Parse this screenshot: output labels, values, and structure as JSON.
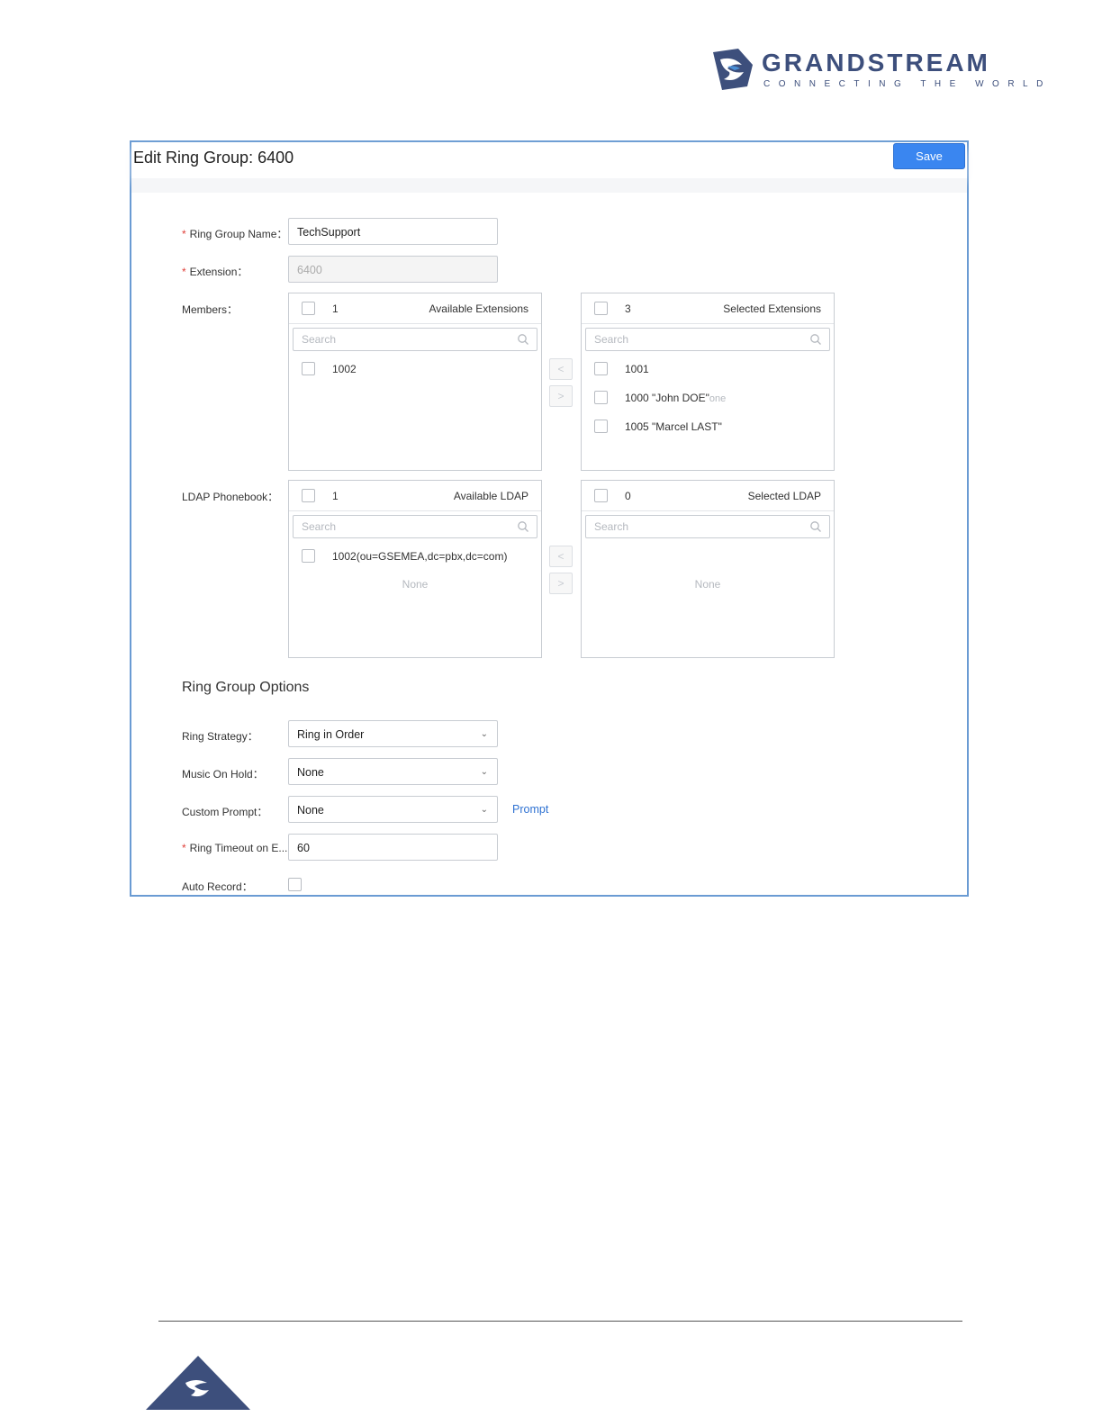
{
  "brand": {
    "name": "GRANDSTREAM",
    "tagline": "CONNECTING THE WORLD",
    "primary_color": "#3d4f7c",
    "icon": "grandstream-logo-icon"
  },
  "header": {
    "title": "Edit Ring Group: 6400",
    "save_label": "Save"
  },
  "form": {
    "ring_group_name": {
      "label": "Ring Group Name：",
      "value": "TechSupport",
      "required": true
    },
    "extension": {
      "label": "Extension：",
      "value": "6400",
      "required": true,
      "disabled": true
    },
    "members": {
      "label": "Members：",
      "available": {
        "count": "1",
        "title": "Available Extensions",
        "search_placeholder": "Search",
        "items": [
          "1002"
        ]
      },
      "selected": {
        "count": "3",
        "title": "Selected Extensions",
        "search_placeholder": "Search",
        "items": [
          "1001",
          "1000 \"John DOE\"",
          "1005 \"Marcel LAST\""
        ],
        "ghost_text": "one"
      },
      "move_left": "<",
      "move_right": ">"
    },
    "ldap": {
      "label": "LDAP Phonebook：",
      "available": {
        "count": "1",
        "title": "Available LDAP",
        "search_placeholder": "Search",
        "items": [
          "1002(ou=GSEMEA,dc=pbx,dc=com)"
        ],
        "empty_text": "None"
      },
      "selected": {
        "count": "0",
        "title": "Selected LDAP",
        "search_placeholder": "Search",
        "empty_text": "None"
      },
      "move_left": "<",
      "move_right": ">"
    }
  },
  "options": {
    "section_title": "Ring Group Options",
    "ring_strategy": {
      "label": "Ring Strategy：",
      "value": "Ring in Order"
    },
    "music_on_hold": {
      "label": "Music On Hold：",
      "value": "None"
    },
    "custom_prompt": {
      "label": "Custom Prompt：",
      "value": "None",
      "link": "Prompt"
    },
    "ring_timeout": {
      "label": "Ring Timeout on E...",
      "value": "60",
      "required": true
    },
    "auto_record": {
      "label": "Auto Record：",
      "checked": false
    }
  },
  "colors": {
    "accent": "#3a86f0",
    "frame_border": "#6a9bd3",
    "required": "#e0403a",
    "link": "#2f72d2"
  }
}
